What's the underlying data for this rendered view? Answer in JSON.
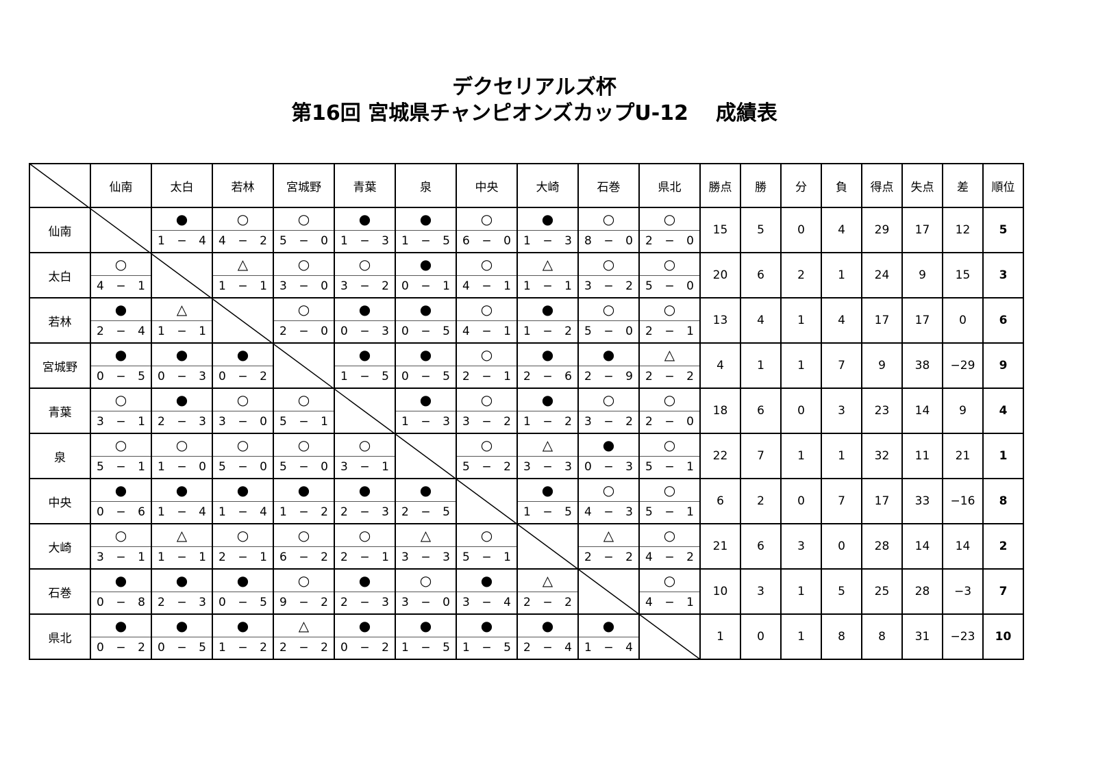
{
  "title": {
    "line1": "デクセリアルズ杯",
    "line2_main": "第16回 宮城県チャンピオンズカップU-12",
    "line2_suffix": "成績表"
  },
  "symbols": {
    "win": "○",
    "loss": "●",
    "draw": "△"
  },
  "teams": [
    "仙南",
    "太白",
    "若林",
    "宮城野",
    "青葉",
    "泉",
    "中央",
    "大崎",
    "石巻",
    "県北"
  ],
  "stat_headers": [
    "勝点",
    "勝",
    "分",
    "負",
    "得点",
    "失点",
    "差",
    "順位"
  ],
  "rows": [
    {
      "team": "仙南",
      "results": [
        null,
        [
          "loss",
          "1",
          "4"
        ],
        [
          "win",
          "4",
          "2"
        ],
        [
          "win",
          "5",
          "0"
        ],
        [
          "loss",
          "1",
          "3"
        ],
        [
          "loss",
          "1",
          "5"
        ],
        [
          "win",
          "6",
          "0"
        ],
        [
          "loss",
          "1",
          "3"
        ],
        [
          "win",
          "8",
          "0"
        ],
        [
          "win",
          "2",
          "0"
        ]
      ],
      "stats": [
        "15",
        "5",
        "0",
        "4",
        "29",
        "17",
        "12"
      ],
      "rank": "5"
    },
    {
      "team": "太白",
      "results": [
        [
          "win",
          "4",
          "1"
        ],
        null,
        [
          "draw",
          "1",
          "1"
        ],
        [
          "win",
          "3",
          "0"
        ],
        [
          "win",
          "3",
          "2"
        ],
        [
          "loss",
          "0",
          "1"
        ],
        [
          "win",
          "4",
          "1"
        ],
        [
          "draw",
          "1",
          "1"
        ],
        [
          "win",
          "3",
          "2"
        ],
        [
          "win",
          "5",
          "0"
        ]
      ],
      "stats": [
        "20",
        "6",
        "2",
        "1",
        "24",
        "9",
        "15"
      ],
      "rank": "3"
    },
    {
      "team": "若林",
      "results": [
        [
          "loss",
          "2",
          "4"
        ],
        [
          "draw",
          "1",
          "1"
        ],
        null,
        [
          "win",
          "2",
          "0"
        ],
        [
          "loss",
          "0",
          "3"
        ],
        [
          "loss",
          "0",
          "5"
        ],
        [
          "win",
          "4",
          "1"
        ],
        [
          "loss",
          "1",
          "2"
        ],
        [
          "win",
          "5",
          "0"
        ],
        [
          "win",
          "2",
          "1"
        ]
      ],
      "stats": [
        "13",
        "4",
        "1",
        "4",
        "17",
        "17",
        "0"
      ],
      "rank": "6"
    },
    {
      "team": "宮城野",
      "results": [
        [
          "loss",
          "0",
          "5"
        ],
        [
          "loss",
          "0",
          "3"
        ],
        [
          "loss",
          "0",
          "2"
        ],
        null,
        [
          "loss",
          "1",
          "5"
        ],
        [
          "loss",
          "0",
          "5"
        ],
        [
          "win",
          "2",
          "1"
        ],
        [
          "loss",
          "2",
          "6"
        ],
        [
          "loss",
          "2",
          "9"
        ],
        [
          "draw",
          "2",
          "2"
        ]
      ],
      "stats": [
        "4",
        "1",
        "1",
        "7",
        "9",
        "38",
        "−29"
      ],
      "rank": "9"
    },
    {
      "team": "青葉",
      "results": [
        [
          "win",
          "3",
          "1"
        ],
        [
          "loss",
          "2",
          "3"
        ],
        [
          "win",
          "3",
          "0"
        ],
        [
          "win",
          "5",
          "1"
        ],
        null,
        [
          "loss",
          "1",
          "3"
        ],
        [
          "win",
          "3",
          "2"
        ],
        [
          "loss",
          "1",
          "2"
        ],
        [
          "win",
          "3",
          "2"
        ],
        [
          "win",
          "2",
          "0"
        ]
      ],
      "stats": [
        "18",
        "6",
        "0",
        "3",
        "23",
        "14",
        "9"
      ],
      "rank": "4"
    },
    {
      "team": "泉",
      "results": [
        [
          "win",
          "5",
          "1"
        ],
        [
          "win",
          "1",
          "0"
        ],
        [
          "win",
          "5",
          "0"
        ],
        [
          "win",
          "5",
          "0"
        ],
        [
          "win",
          "3",
          "1"
        ],
        null,
        [
          "win",
          "5",
          "2"
        ],
        [
          "draw",
          "3",
          "3"
        ],
        [
          "loss",
          "0",
          "3"
        ],
        [
          "win",
          "5",
          "1"
        ]
      ],
      "stats": [
        "22",
        "7",
        "1",
        "1",
        "32",
        "11",
        "21"
      ],
      "rank": "1"
    },
    {
      "team": "中央",
      "results": [
        [
          "loss",
          "0",
          "6"
        ],
        [
          "loss",
          "1",
          "4"
        ],
        [
          "loss",
          "1",
          "4"
        ],
        [
          "loss",
          "1",
          "2"
        ],
        [
          "loss",
          "2",
          "3"
        ],
        [
          "loss",
          "2",
          "5"
        ],
        null,
        [
          "loss",
          "1",
          "5"
        ],
        [
          "win",
          "4",
          "3"
        ],
        [
          "win",
          "5",
          "1"
        ]
      ],
      "stats": [
        "6",
        "2",
        "0",
        "7",
        "17",
        "33",
        "−16"
      ],
      "rank": "8"
    },
    {
      "team": "大崎",
      "results": [
        [
          "win",
          "3",
          "1"
        ],
        [
          "draw",
          "1",
          "1"
        ],
        [
          "win",
          "2",
          "1"
        ],
        [
          "win",
          "6",
          "2"
        ],
        [
          "win",
          "2",
          "1"
        ],
        [
          "draw",
          "3",
          "3"
        ],
        [
          "win",
          "5",
          "1"
        ],
        null,
        [
          "draw",
          "2",
          "2"
        ],
        [
          "win",
          "4",
          "2"
        ]
      ],
      "stats": [
        "21",
        "6",
        "3",
        "0",
        "28",
        "14",
        "14"
      ],
      "rank": "2"
    },
    {
      "team": "石巻",
      "results": [
        [
          "loss",
          "0",
          "8"
        ],
        [
          "loss",
          "2",
          "3"
        ],
        [
          "loss",
          "0",
          "5"
        ],
        [
          "win",
          "9",
          "2"
        ],
        [
          "loss",
          "2",
          "3"
        ],
        [
          "win",
          "3",
          "0"
        ],
        [
          "loss",
          "3",
          "4"
        ],
        [
          "draw",
          "2",
          "2"
        ],
        null,
        [
          "win",
          "4",
          "1"
        ]
      ],
      "stats": [
        "10",
        "3",
        "1",
        "5",
        "25",
        "28",
        "−3"
      ],
      "rank": "7"
    },
    {
      "team": "県北",
      "results": [
        [
          "loss",
          "0",
          "2"
        ],
        [
          "loss",
          "0",
          "5"
        ],
        [
          "loss",
          "1",
          "2"
        ],
        [
          "draw",
          "2",
          "2"
        ],
        [
          "loss",
          "0",
          "2"
        ],
        [
          "loss",
          "1",
          "5"
        ],
        [
          "loss",
          "1",
          "5"
        ],
        [
          "loss",
          "2",
          "4"
        ],
        [
          "loss",
          "1",
          "4"
        ],
        null
      ],
      "stats": [
        "1",
        "0",
        "1",
        "8",
        "8",
        "31",
        "−23"
      ],
      "rank": "10"
    }
  ]
}
